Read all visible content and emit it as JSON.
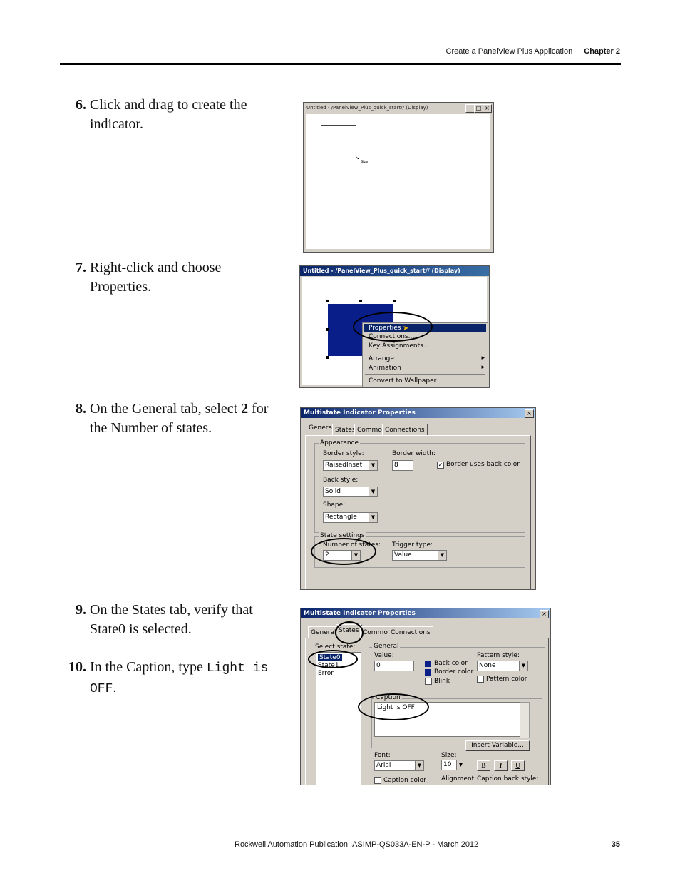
{
  "header": {
    "section": "Create a PanelView Plus Application",
    "chapter": "Chapter 2"
  },
  "steps": [
    {
      "num": "6.",
      "text": "Click and drag to create the indicator."
    },
    {
      "num": "7.",
      "text": "Right-click and choose Properties."
    },
    {
      "num_8": "8.",
      "pre": "On the General tab, select ",
      "bold": "2",
      "post": " for the Number of states."
    },
    {
      "num": "9.",
      "text": "On the States tab, verify that State0 is selected."
    },
    {
      "num": "10.",
      "pre": "In the Caption, type ",
      "code": "Light is OFF",
      "post": "."
    }
  ],
  "shot1": {
    "title": "Untitled - /PanelView_Plus_quick_start// (Display)",
    "cursor_label": "Size"
  },
  "shot2": {
    "title": "Untitled - /PanelView_Plus_quick_start// (Display)",
    "menu": [
      "Properties",
      "Connections...",
      "Key Assignments...",
      "Arrange",
      "Animation",
      "Convert to Wallpaper"
    ]
  },
  "shot3": {
    "title": "Multistate Indicator Properties",
    "tabs": [
      "General",
      "States",
      "Common",
      "Connections"
    ],
    "appearance": "Appearance",
    "border_style_label": "Border style:",
    "border_style": "RaisedInset",
    "border_width_label": "Border width:",
    "border_width": "8",
    "border_back_label": "Border uses back color",
    "back_style_label": "Back style:",
    "back_style": "Solid",
    "shape_label": "Shape:",
    "shape": "Rectangle",
    "state_settings": "State settings",
    "num_states_label": "Number of states:",
    "num_states": "2",
    "trigger_label": "Trigger type:",
    "trigger": "Value"
  },
  "shot4": {
    "title": "Multistate Indicator Properties",
    "tabs": [
      "General",
      "States",
      "Common",
      "Connections"
    ],
    "select_state": "Select state:",
    "states": [
      "State0",
      "State1",
      "Error"
    ],
    "general": "General",
    "value_label": "Value:",
    "value": "0",
    "back_color": "Back color",
    "border_color": "Border color",
    "blink": "Blink",
    "pattern_style_label": "Pattern style:",
    "pattern_style": "None",
    "pattern_color": "Pattern color",
    "caption_label": "Caption",
    "caption": "Light is OFF",
    "insert_variable": "Insert Variable...",
    "font_label": "Font:",
    "font": "Arial",
    "size_label": "Size:",
    "size": "10",
    "bold": "B",
    "italic": "I",
    "underline": "U",
    "caption_color": "Caption color",
    "alignment": "Alignment:",
    "caption_back_style": "Caption back style:"
  },
  "footer": {
    "publication": "Rockwell Automation Publication IASIMP-QS033A-EN-P - March 2012",
    "page": "35"
  }
}
